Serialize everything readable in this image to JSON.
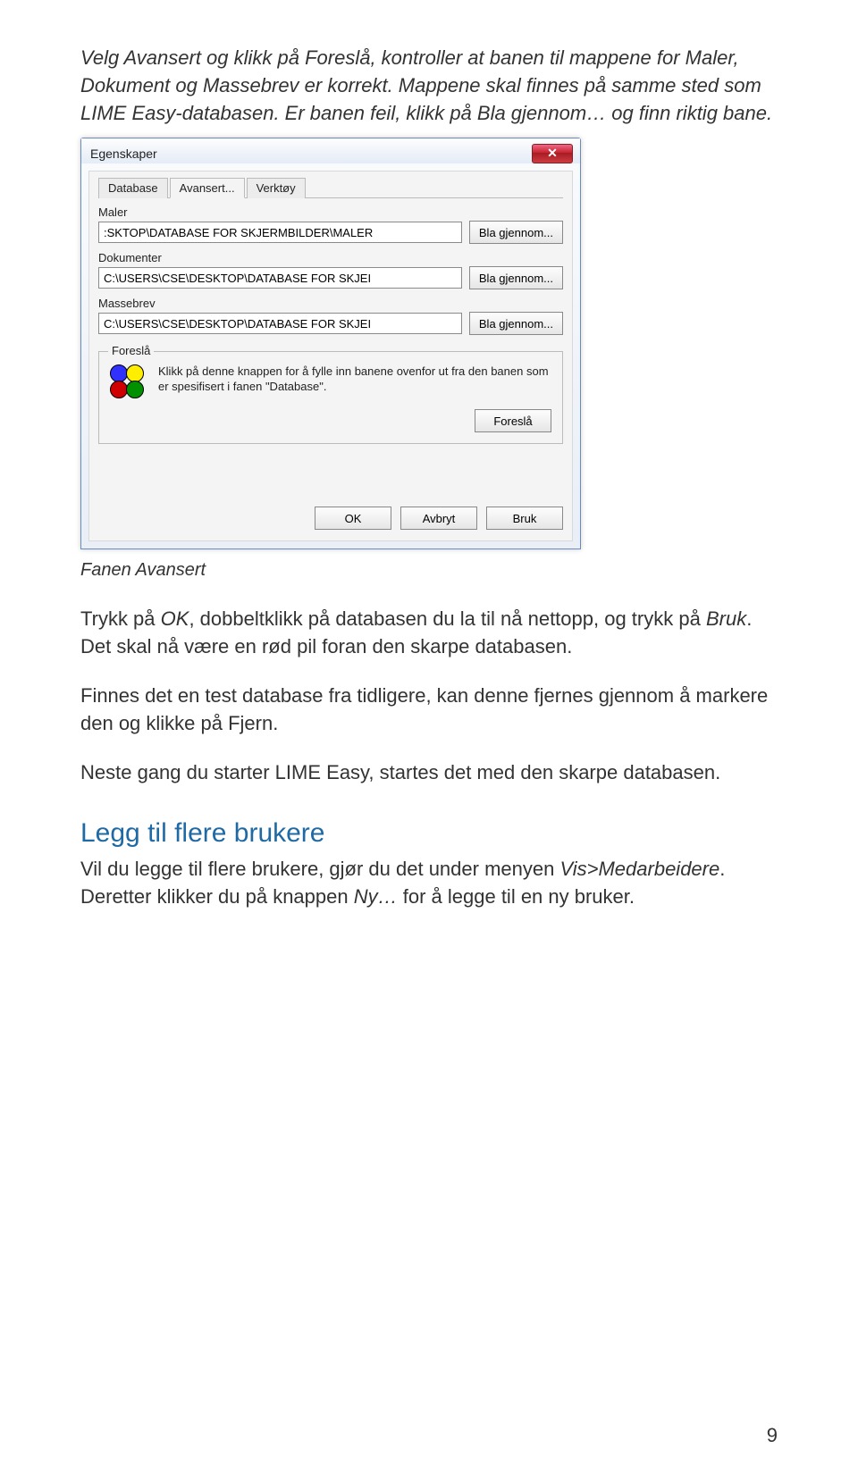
{
  "intro": {
    "line": "Velg Avansert og klikk på Foreslå, kontroller at banen til mappene for Maler, Dokument og Massebrev er korrekt. Mappene skal finnes på samme sted som LIME Easy-databasen. Er banen feil, klikk på Bla gjennom… og finn riktig bane."
  },
  "dialog": {
    "title": "Egenskaper",
    "close": "✕",
    "tabs": {
      "t1": "Database",
      "t2": "Avansert...",
      "t3": "Verktøy"
    },
    "fields": {
      "maler_label": "Maler",
      "maler_value": ":SKTOP\\DATABASE FOR SKJERMBILDER\\MALER",
      "dok_label": "Dokumenter",
      "dok_value": "C:\\USERS\\CSE\\DESKTOP\\DATABASE FOR SKJEI",
      "masse_label": "Massebrev",
      "masse_value": "C:\\USERS\\CSE\\DESKTOP\\DATABASE FOR SKJEI",
      "browse": "Bla gjennom..."
    },
    "foresla": {
      "legend": "Foreslå",
      "text": "Klikk på denne knappen for å fylle inn banene ovenfor ut fra den banen som er spesifisert i fanen \"Database\".",
      "button": "Foreslå"
    },
    "buttons": {
      "ok": "OK",
      "cancel": "Avbryt",
      "apply": "Bruk"
    }
  },
  "caption": "Fanen Avansert",
  "para1_a": "Trykk på ",
  "para1_ok": "OK",
  "para1_b": ", dobbeltklikk på databasen du la til nå nettopp, og trykk på ",
  "para1_bruk": "Bruk",
  "para1_c": ". Det skal nå være en rød pil foran den skarpe databasen.",
  "para2": "Finnes det en test database fra tidligere, kan denne fjernes gjennom å markere den og klikke på Fjern.",
  "para3": "Neste gang du starter LIME Easy, startes det med den skarpe databasen.",
  "h2": "Legg til flere brukere",
  "para4_a": "Vil du legge til flere brukere, gjør du det under menyen ",
  "para4_menu": "Vis>Medarbeidere",
  "para4_b": ". Deretter klikker du på knappen ",
  "para4_ny": "Ny…",
  "para4_c": " for å legge til en ny bruker.",
  "page": "9"
}
